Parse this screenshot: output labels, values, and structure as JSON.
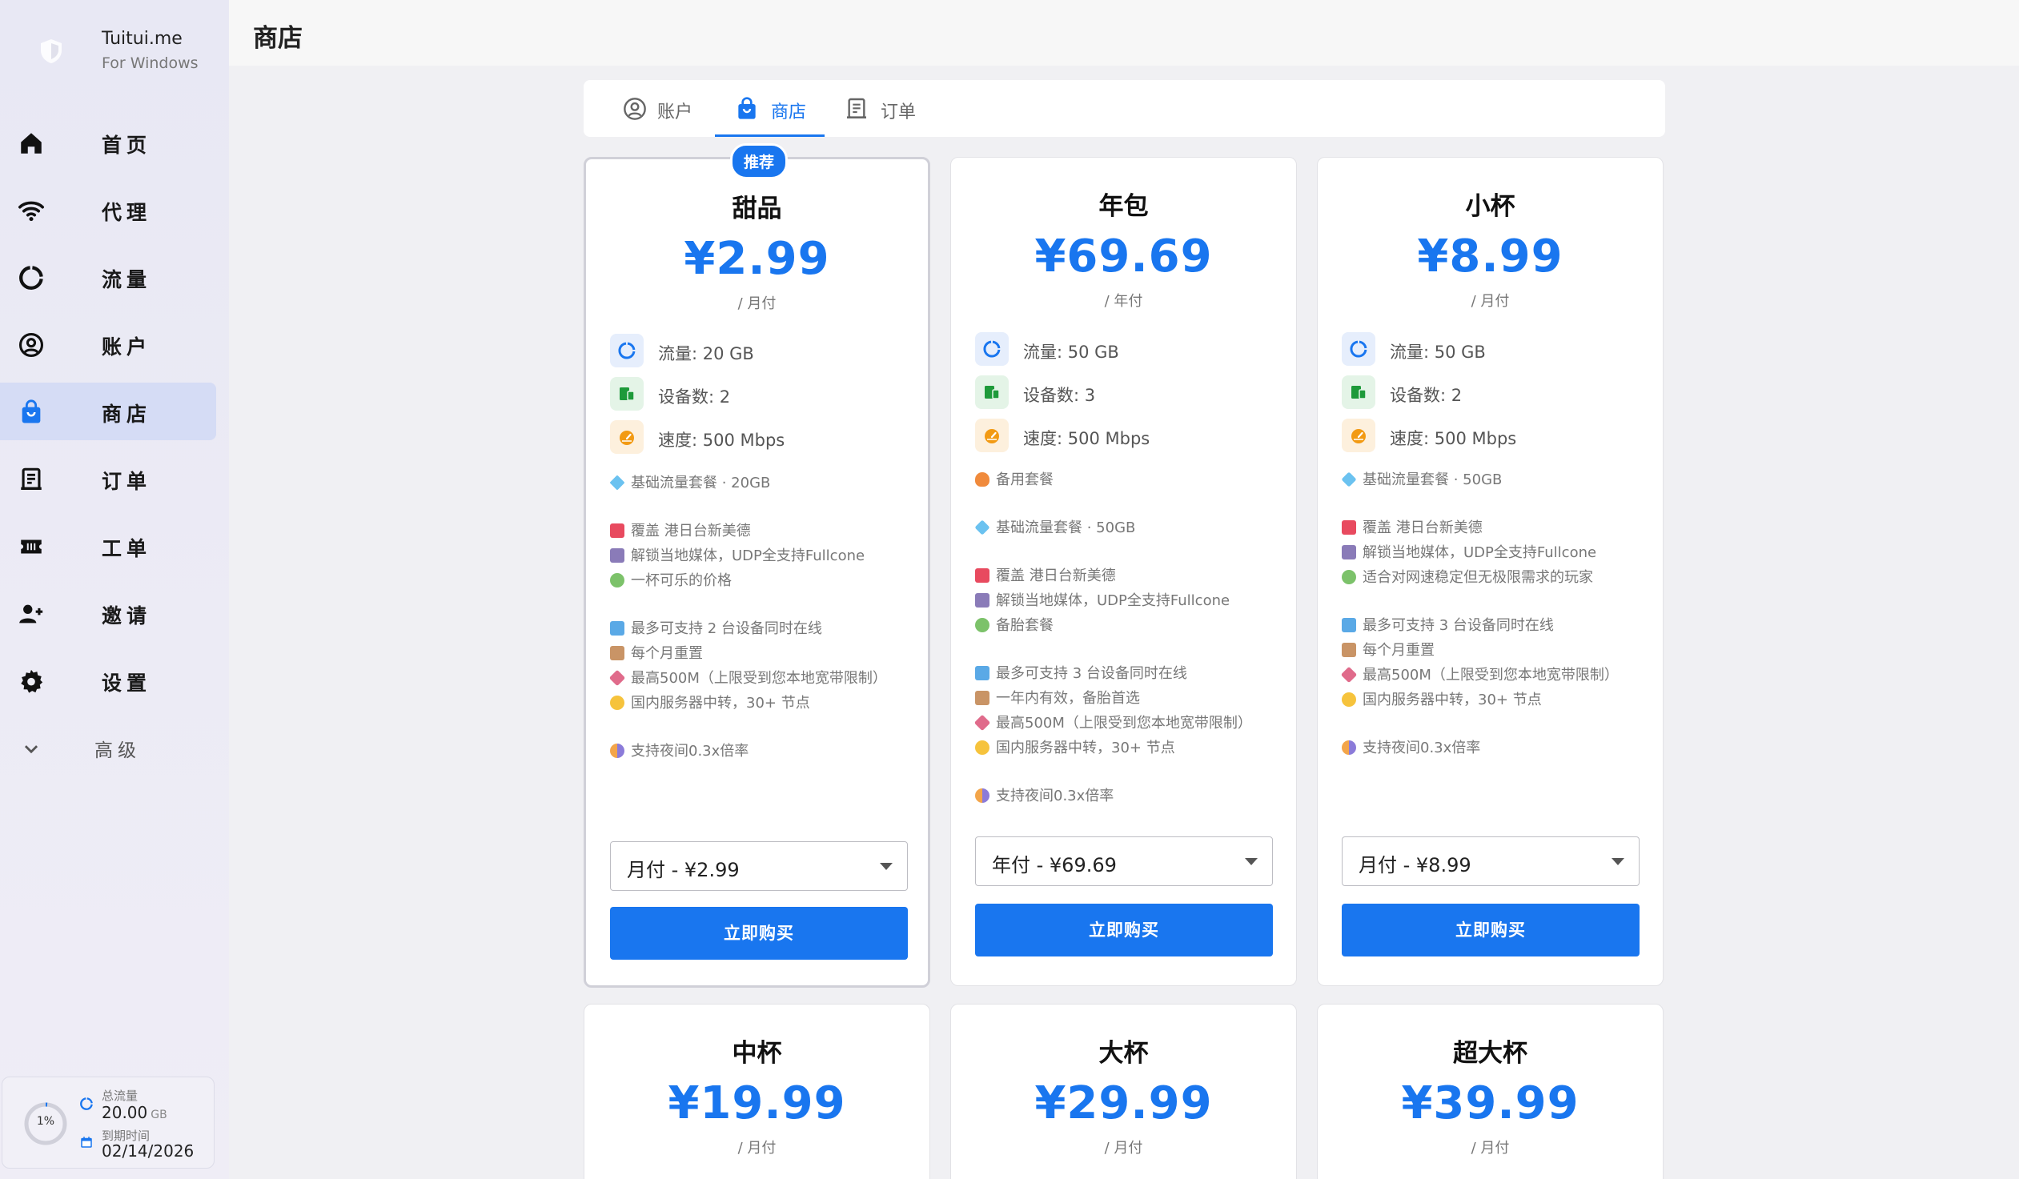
{
  "app": {
    "name": "Tuitui.me",
    "subtitle": "For Windows"
  },
  "header": {
    "title": "商店"
  },
  "sidebar": {
    "items": [
      {
        "label": "首页",
        "icon": "home-icon"
      },
      {
        "label": "代理",
        "icon": "wifi-icon"
      },
      {
        "label": "流量",
        "icon": "donut-icon"
      },
      {
        "label": "账户",
        "icon": "account-icon"
      },
      {
        "label": "商店",
        "icon": "shopping-bag-icon",
        "active": true
      },
      {
        "label": "订单",
        "icon": "receipt-icon"
      },
      {
        "label": "工单",
        "icon": "ticket-icon"
      },
      {
        "label": "邀请",
        "icon": "invite-user-icon"
      },
      {
        "label": "设置",
        "icon": "gear-icon"
      }
    ],
    "advanced_label": "高级",
    "usage": {
      "percent": "1%",
      "total_label": "总流量",
      "total_value": "20.00",
      "total_unit": "GB",
      "expire_label": "到期时间",
      "expire_value": "02/14/2026"
    }
  },
  "tabs": [
    {
      "label": "账户",
      "icon": "account-icon"
    },
    {
      "label": "商店",
      "icon": "shopping-bag-icon",
      "active": true
    },
    {
      "label": "订单",
      "icon": "receipt-icon"
    }
  ],
  "colors": {
    "accent": "#1976ef",
    "sidebar_active": "#d5dcf5"
  },
  "plans": [
    {
      "badge": "推荐",
      "name": "甜品",
      "price": "¥2.99",
      "period": "/ 月付",
      "specs": [
        "流量: 20 GB",
        "设备数: 2",
        "速度: 500 Mbps"
      ],
      "features": [
        "基础流量套餐 · 20GB",
        "覆盖 港日台新美德",
        "解锁当地媒体，UDP全支持Fullcone",
        "一杯可乐的价格",
        "最多可支持 2 台设备同时在线",
        "每个月重置",
        "最高500M（上限受到您本地宽带限制）",
        "国内服务器中转，30+ 节点",
        "支持夜间0.3x倍率"
      ],
      "select": "月付 - ¥2.99",
      "buy": "立即购买"
    },
    {
      "name": "年包",
      "price": "¥69.69",
      "period": "/ 年付",
      "specs": [
        "流量: 50 GB",
        "设备数: 3",
        "速度: 500 Mbps"
      ],
      "features": [
        "备用套餐",
        "基础流量套餐 · 50GB",
        "覆盖 港日台新美德",
        "解锁当地媒体，UDP全支持Fullcone",
        "备胎套餐",
        "最多可支持 3 台设备同时在线",
        "一年内有效，备胎首选",
        "最高500M（上限受到您本地宽带限制）",
        "国内服务器中转，30+ 节点",
        "支持夜间0.3x倍率"
      ],
      "select": "年付 - ¥69.69",
      "buy": "立即购买"
    },
    {
      "name": "小杯",
      "price": "¥8.99",
      "period": "/ 月付",
      "specs": [
        "流量: 50 GB",
        "设备数: 2",
        "速度: 500 Mbps"
      ],
      "features": [
        "基础流量套餐 · 50GB",
        "覆盖 港日台新美德",
        "解锁当地媒体，UDP全支持Fullcone",
        "适合对网速稳定但无极限需求的玩家",
        "最多可支持 3 台设备同时在线",
        "每个月重置",
        "最高500M（上限受到您本地宽带限制）",
        "国内服务器中转，30+ 节点",
        "支持夜间0.3x倍率"
      ],
      "select": "月付 - ¥8.99",
      "buy": "立即购买"
    },
    {
      "name": "中杯",
      "price": "¥19.99",
      "period": "/ 月付"
    },
    {
      "name": "大杯",
      "price": "¥29.99",
      "period": "/ 月付"
    },
    {
      "name": "超大杯",
      "price": "¥39.99",
      "period": "/ 月付"
    }
  ]
}
